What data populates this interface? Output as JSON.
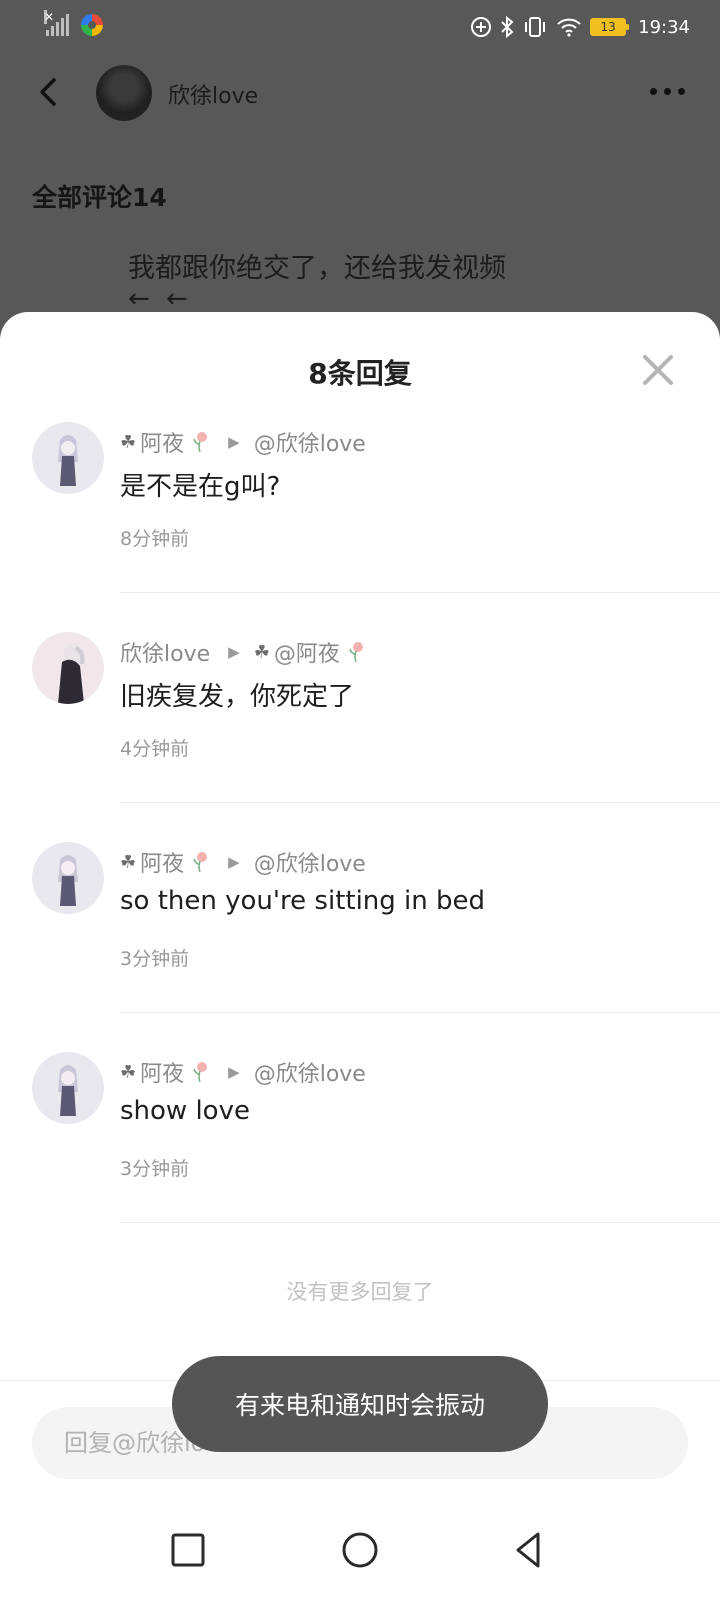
{
  "status_bar": {
    "time": "19:34",
    "battery": "13"
  },
  "top_bar": {
    "username": "欣徐love"
  },
  "background": {
    "section_title": "全部评论14",
    "comment_text": "我都跟你绝交了，还给我发视频",
    "comment_emoji": "← ←"
  },
  "sheet": {
    "title": "8条回复",
    "replies": [
      {
        "author": "阿夜",
        "target": "@欣徐love",
        "text": "是不是在g叫?",
        "time": "8分钟前"
      },
      {
        "author": "欣徐love",
        "target": "@阿夜",
        "text": "旧疾复发，你死定了",
        "time": "4分钟前"
      },
      {
        "author": "阿夜",
        "target": "@欣徐love",
        "text": "so then you're sitting in bed",
        "time": "3分钟前"
      },
      {
        "author": "阿夜",
        "target": "@欣徐love",
        "text": "show love",
        "time": "3分钟前"
      }
    ],
    "no_more": "没有更多回复了",
    "input_placeholder": "回复@欣徐love:"
  },
  "toast": "有来电和通知时会振动",
  "colors": {
    "dim_background": "#585858",
    "sheet": "#ffffff",
    "meta_gray": "#8a8a8a",
    "input_bg": "#f4f4f4",
    "toast_bg": "#555555"
  },
  "icons": [
    "back-arrow-icon",
    "more-dots-icon",
    "close-icon",
    "clover-icon",
    "flower-icon",
    "play-triangle-icon",
    "square-nav-icon",
    "circle-nav-icon",
    "triangle-back-nav-icon"
  ]
}
